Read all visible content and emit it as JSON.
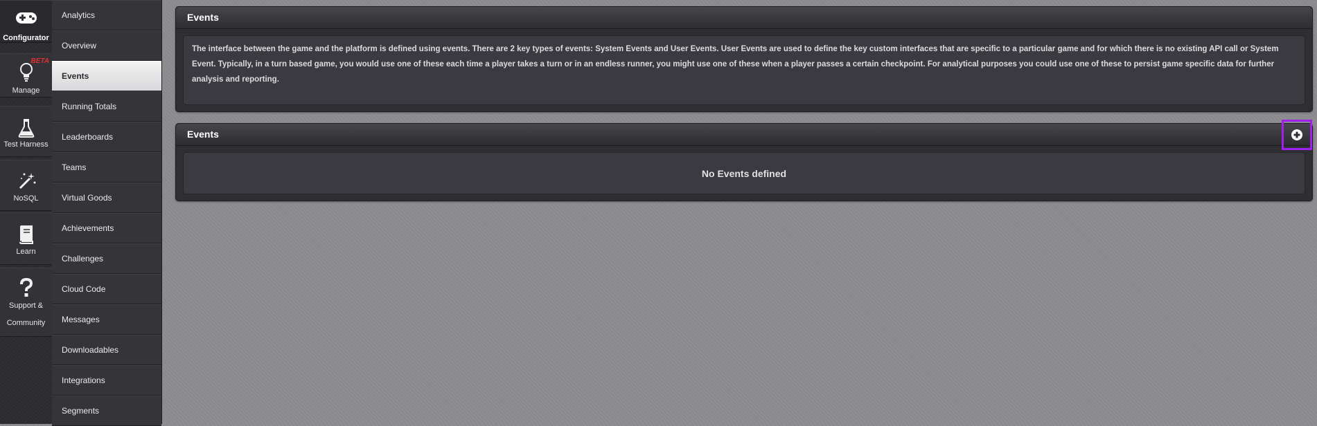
{
  "rail": {
    "items": [
      {
        "label": "Configurator",
        "icon": "gamepad-icon",
        "active": true
      },
      {
        "label": "Manage",
        "icon": "lightbulb-icon",
        "badge": "BETA"
      },
      {
        "label": "Test Harness",
        "icon": "flask-icon"
      },
      {
        "label": "NoSQL",
        "icon": "magic-wand-icon"
      },
      {
        "label": "Learn",
        "icon": "book-icon"
      },
      {
        "label_line1": "Support &",
        "label_line2": "Community",
        "icon": "question-icon"
      }
    ]
  },
  "menu": {
    "items": [
      {
        "label": "Analytics"
      },
      {
        "label": "Overview"
      },
      {
        "label": "Events",
        "active": true
      },
      {
        "label": "Running Totals"
      },
      {
        "label": "Leaderboards"
      },
      {
        "label": "Teams"
      },
      {
        "label": "Virtual Goods"
      },
      {
        "label": "Achievements"
      },
      {
        "label": "Challenges"
      },
      {
        "label": "Cloud Code"
      },
      {
        "label": "Messages"
      },
      {
        "label": "Downloadables"
      },
      {
        "label": "Integrations"
      },
      {
        "label": "Segments"
      }
    ]
  },
  "intro_panel": {
    "title": "Events",
    "text": "The interface between the game and the platform is defined using events. There are 2 key types of events: System Events and User Events. User Events are used to define the key custom interfaces that are specific to a particular game and for which there is no existing API call or System Event. Typically, in a turn based game, you would use one of these each time a player takes a turn or in an endless runner, you might use one of these when a player passes a certain checkpoint. For analytical purposes you could use one of these to persist game specific data for further analysis and reporting."
  },
  "events_panel": {
    "title": "Events",
    "empty_message": "No Events defined",
    "add_icon": "plus-circle-icon"
  },
  "colors": {
    "highlight": "#a020f0",
    "beta_badge": "#e03030",
    "active_menu_bg": "#e6e6e8"
  }
}
